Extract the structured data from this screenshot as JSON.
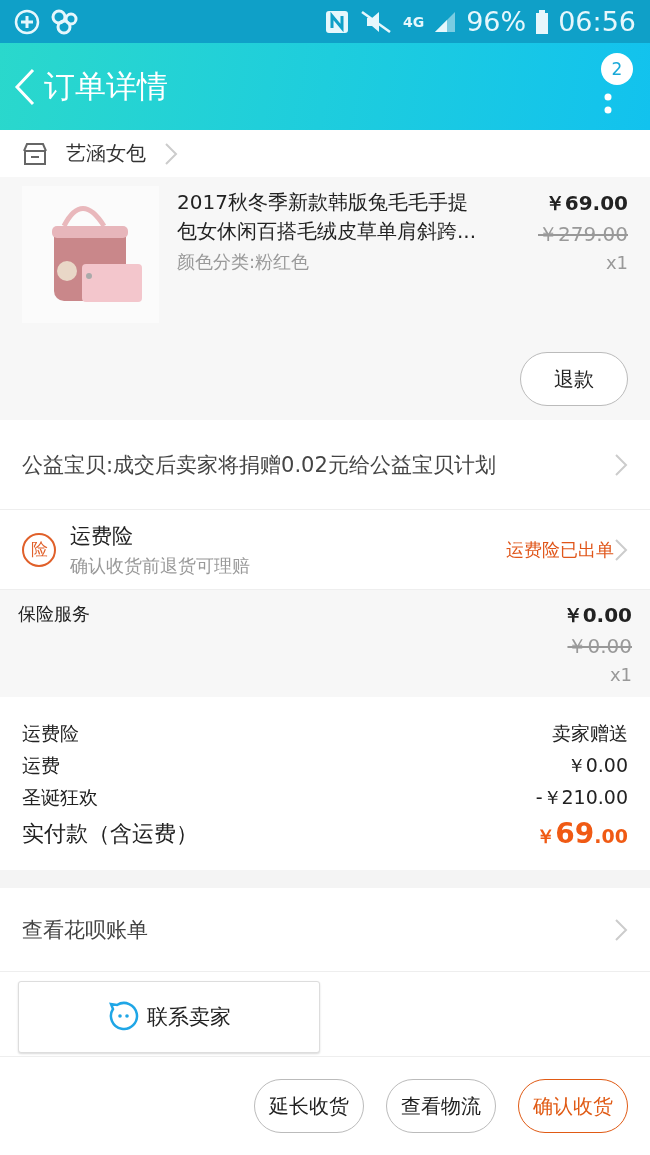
{
  "status_bar": {
    "network": "4G",
    "battery": "96%",
    "time": "06:56"
  },
  "header": {
    "title": "订单详情",
    "badge": "2"
  },
  "shop": {
    "name": "艺涵女包"
  },
  "product": {
    "title": "2017秋冬季新款韩版兔毛毛手提包女休闲百搭毛绒皮草单肩斜跨...",
    "variant": "颜色分类:粉红色",
    "price": "￥69.00",
    "original_price": "￥279.00",
    "quantity": "x1",
    "refund_button": "退款"
  },
  "charity": {
    "text": "公益宝贝:成交后卖家将捐赠0.02元给公益宝贝计划"
  },
  "shipping_insurance": {
    "badge": "险",
    "title": "运费险",
    "subtitle": "确认收货前退货可理赔",
    "status": "运费险已出单"
  },
  "insurance_service": {
    "label": "保险服务",
    "price": "￥0.00",
    "original_price": "￥0.00",
    "quantity": "x1"
  },
  "summary": {
    "rows": [
      {
        "label": "运费险",
        "value": "卖家赠送"
      },
      {
        "label": "运费",
        "value": "￥0.00"
      },
      {
        "label": "圣诞狂欢",
        "value": "-￥210.00"
      }
    ],
    "total": {
      "label": "实付款（含运费）",
      "currency": "￥",
      "integer": "69",
      "decimal": ".00"
    }
  },
  "huabei": {
    "label": "查看花呗账单"
  },
  "contact_button": "联系卖家",
  "actions": [
    {
      "label": "延长收货",
      "kind": "normal"
    },
    {
      "label": "查看物流",
      "kind": "normal"
    },
    {
      "label": "确认收货",
      "kind": "primary"
    }
  ]
}
